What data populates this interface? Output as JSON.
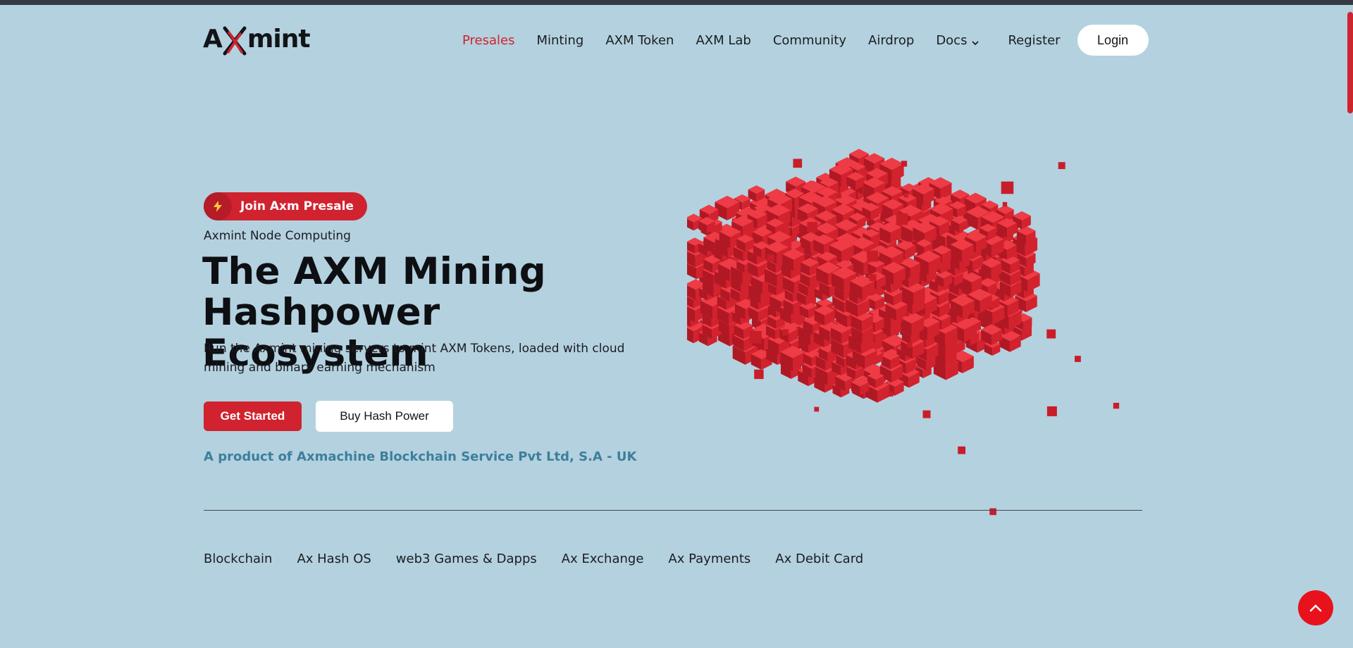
{
  "brand": {
    "logo_text": "Axmint",
    "accent_color": "#d0232f"
  },
  "nav": {
    "items": [
      {
        "label": "Presales",
        "active": true
      },
      {
        "label": "Minting",
        "active": false
      },
      {
        "label": "AXM Token",
        "active": false
      },
      {
        "label": "AXM Lab",
        "active": false
      },
      {
        "label": "Community",
        "active": false
      },
      {
        "label": "Airdrop",
        "active": false
      }
    ],
    "docs_label": "Docs",
    "register_label": "Register",
    "login_label": "Login"
  },
  "hero": {
    "presale_pill": {
      "icon": "lightning-bolt-icon",
      "label": "Join Axm Presale"
    },
    "eyebrow": "Axmint Node Computing",
    "headline_line1": "The AXM Mining",
    "headline_line2": "Hashpower Ecosystem",
    "subtext": "Run the Axmint mining servers to mint AXM Tokens, loaded with cloud mining and binary earning mechanism",
    "primary_cta": "Get Started",
    "secondary_cta": "Buy Hash Power",
    "product_note": "A product of Axmachine Blockchain Service Pvt Ltd, S.A - UK"
  },
  "services": [
    "Blockchain",
    "Ax Hash OS",
    "web3 Games & Dapps",
    "Ax Exchange",
    "Ax Payments",
    "Ax Debit Card"
  ],
  "back_to_top": {
    "icon": "chevron-up-icon"
  }
}
